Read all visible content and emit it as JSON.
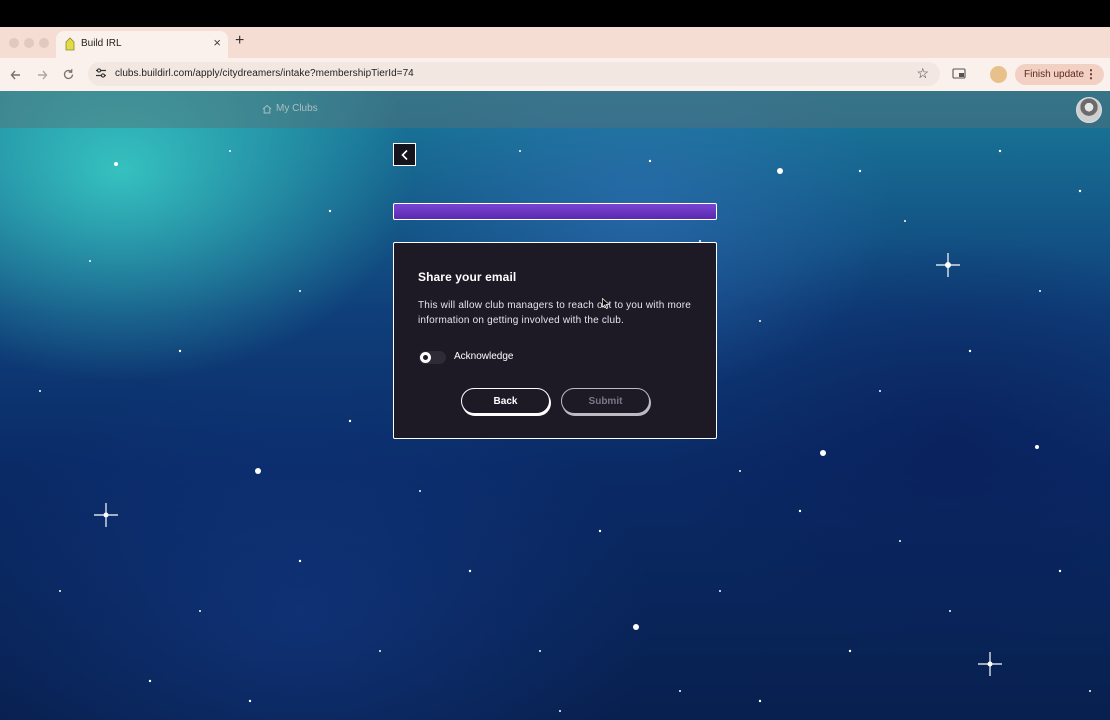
{
  "browser": {
    "tab_title": "Build IRL",
    "close_tab": "×",
    "new_tab": "+",
    "url": "clubs.buildirl.com/apply/citydreamers/intake?membershipTierId=74",
    "finish_update_label": "Finish update"
  },
  "site": {
    "nav_my_clubs": "My Clubs"
  },
  "progress": {
    "value_fraction": 1.0,
    "color": "#6a34c2"
  },
  "form": {
    "title": "Share your email",
    "description": "This will allow club managers to reach out to you with more information on getting involved with the club.",
    "toggle_label": "Acknowledge",
    "toggle_on": false,
    "back_label": "Back",
    "submit_label": "Submit",
    "submit_disabled": true
  },
  "icons": {
    "favicon": "build-irl-favicon",
    "back_arrow": "chevron-left-icon",
    "home": "home-icon"
  }
}
